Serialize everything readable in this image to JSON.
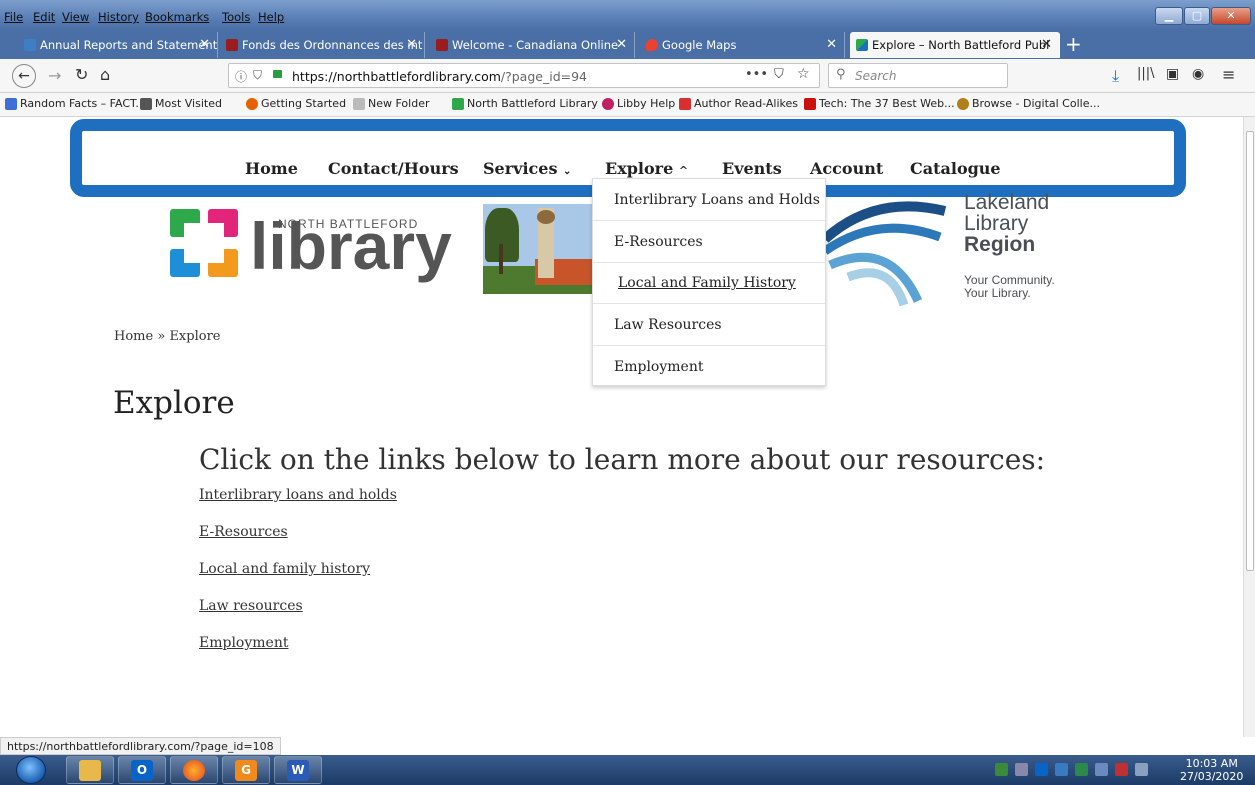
{
  "menubar": {
    "items": [
      "File",
      "Edit",
      "View",
      "History",
      "Bookmarks",
      "Tools",
      "Help"
    ]
  },
  "tabs": [
    {
      "label": "Annual Reports and Statements",
      "active": false
    },
    {
      "label": "Fonds des Ordonnances des int",
      "active": false
    },
    {
      "label": "Welcome - Canadiana Online",
      "active": false
    },
    {
      "label": "Google Maps",
      "active": false
    },
    {
      "label": "Explore – North Battleford Publ",
      "active": true
    }
  ],
  "navbar": {
    "url_host": "https://northbattlefordlibrary.com",
    "url_path": "/?page_id=94",
    "search_placeholder": "Search"
  },
  "bookmarks": [
    {
      "label": "Random Facts – FACT...",
      "color": "#3f6fd6"
    },
    {
      "label": "Most Visited",
      "color": "#555555"
    },
    {
      "label": "Getting Started",
      "color": "#e66000"
    },
    {
      "label": "New Folder",
      "color": "#9a9a9a"
    },
    {
      "label": "North Battleford Library",
      "color": "#2da84a"
    },
    {
      "label": "Libby Help",
      "color": "#c02060"
    },
    {
      "label": "Author Read-Alikes",
      "color": "#d83030"
    },
    {
      "label": "Tech: The 37 Best Web...",
      "color": "#cc1111"
    },
    {
      "label": "Browse - Digital Colle...",
      "color": "#b0801a"
    }
  ],
  "site_nav": {
    "items": [
      "Home",
      "Contact/Hours",
      "Services",
      "Explore",
      "Events",
      "Account",
      "Catalogue"
    ]
  },
  "explore_dropdown": {
    "items": [
      "Interlibrary Loans and Holds",
      "E-Resources",
      "Local and Family History",
      "Law Resources",
      "Employment"
    ]
  },
  "logos": {
    "nb_small": "NORTH BATTLEFORD",
    "nb_big": "library",
    "lakeland_name_1": "Lakeland",
    "lakeland_name_2": "Library",
    "lakeland_name_3": "Region",
    "lakeland_tag_1": "Your Community.",
    "lakeland_tag_2": "Your Library."
  },
  "breadcrumb": {
    "home": "Home",
    "sep": "»",
    "current": "Explore"
  },
  "page": {
    "title": "Explore",
    "subtitle": "Click on the links below to learn more about our resources:",
    "links": [
      "Interlibrary loans and holds",
      "E-Resources",
      "Local and family history",
      "Law resources",
      "Employment"
    ]
  },
  "status_url": "https://northbattlefordlibrary.com/?page_id=108",
  "clock": {
    "time": "10:03 AM",
    "date": "27/03/2020"
  },
  "colors": {
    "nav_border": "#1e6fc0",
    "taskbar": "#1c3b66"
  }
}
